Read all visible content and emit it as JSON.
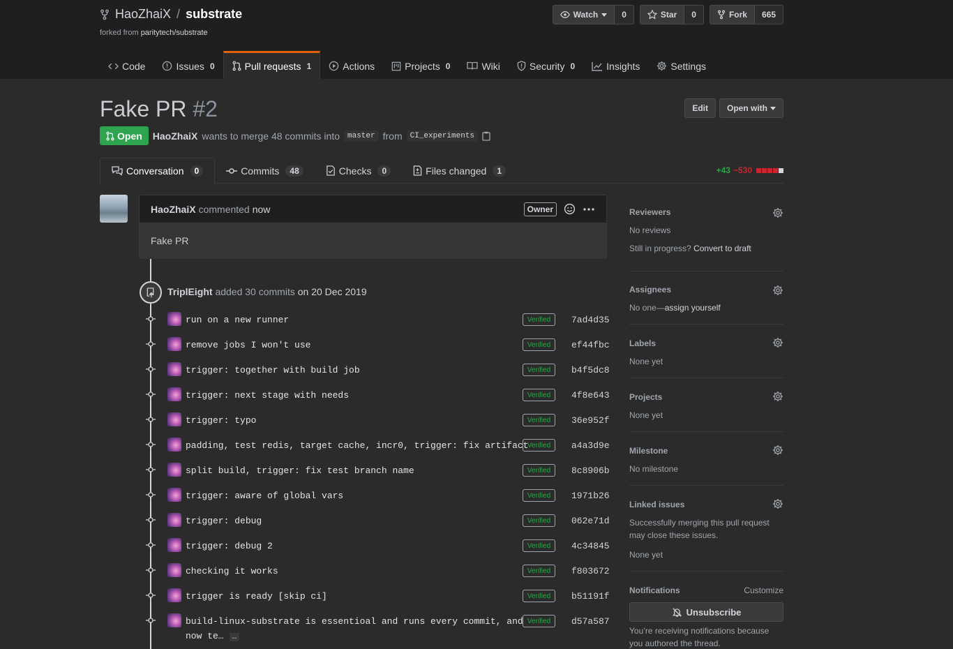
{
  "repo": {
    "owner": "HaoZhaiX",
    "separator": "/",
    "name": "substrate",
    "forked_prefix": "forked from ",
    "forked_from": "paritytech/substrate"
  },
  "actions": {
    "watch_label": "Watch",
    "watch_count": "0",
    "star_label": "Star",
    "star_count": "0",
    "fork_label": "Fork",
    "fork_count": "665"
  },
  "reponav": {
    "code": "Code",
    "issues": "Issues",
    "issues_count": "0",
    "pulls": "Pull requests",
    "pulls_count": "1",
    "actions": "Actions",
    "projects": "Projects",
    "projects_count": "0",
    "wiki": "Wiki",
    "security": "Security",
    "security_count": "0",
    "insights": "Insights",
    "settings": "Settings"
  },
  "pr": {
    "title": "Fake PR",
    "number": "#2",
    "edit_label": "Edit",
    "open_with_label": "Open with",
    "state": "Open",
    "author": "HaoZhaiX",
    "merge_text": "wants to merge 48 commits into",
    "base": "master",
    "from_text": "from",
    "head": "CI_experiments"
  },
  "tabs": {
    "conversation": "Conversation",
    "conversation_count": "0",
    "commits": "Commits",
    "commits_count": "48",
    "checks": "Checks",
    "checks_count": "0",
    "files": "Files changed",
    "files_count": "1",
    "additions": "+43",
    "deletions": "−530"
  },
  "comment": {
    "author": "HaoZhaiX",
    "action": "commented",
    "time": "now",
    "badge": "Owner",
    "body": "Fake PR"
  },
  "push_event": {
    "actor": "TriplEight",
    "action": "added 30 commits",
    "on_prefix": "on",
    "date": "20 Dec 2019"
  },
  "commits": [
    {
      "message": "run on a new runner",
      "verified": "Verified",
      "sha": "7ad4d35"
    },
    {
      "message": "remove jobs I won't use",
      "verified": "Verified",
      "sha": "ef44fbc"
    },
    {
      "message": "trigger: together with build job",
      "verified": "Verified",
      "sha": "b4f5dc8"
    },
    {
      "message": "trigger: next stage with needs",
      "verified": "Verified",
      "sha": "4f8e643"
    },
    {
      "message": "trigger: typo",
      "verified": "Verified",
      "sha": "36e952f"
    },
    {
      "message": "padding, test redis, target cache, incr0, trigger: fix artifact",
      "verified": "Verified",
      "sha": "a4a3d9e"
    },
    {
      "message": "split build, trigger: fix test branch name",
      "verified": "Verified",
      "sha": "8c8906b"
    },
    {
      "message": "trigger: aware of global vars",
      "verified": "Verified",
      "sha": "1971b26"
    },
    {
      "message": "trigger: debug",
      "verified": "Verified",
      "sha": "062e71d"
    },
    {
      "message": "trigger: debug 2",
      "verified": "Verified",
      "sha": "4c34845"
    },
    {
      "message": "checking it works",
      "verified": "Verified",
      "sha": "f803672"
    },
    {
      "message": "trigger is ready [skip ci]",
      "verified": "Verified",
      "sha": "b51191f"
    },
    {
      "message": "build-linux-substrate is essentioal and runs every commit, and",
      "message_line2": "now te…",
      "ellipsis": "…",
      "verified": "Verified",
      "sha": "d57a587"
    }
  ],
  "sidebar": {
    "reviewers_title": "Reviewers",
    "reviewers_text": "No reviews",
    "draft_prefix": "Still in progress?",
    "draft_link": "Convert to draft",
    "assignees_title": "Assignees",
    "assignees_prefix": "No one—",
    "assignees_link": "assign yourself",
    "labels_title": "Labels",
    "labels_text": "None yet",
    "projects_title": "Projects",
    "projects_text": "None yet",
    "milestone_title": "Milestone",
    "milestone_text": "No milestone",
    "linked_title": "Linked issues",
    "linked_line1": "Successfully merging this pull request",
    "linked_line2": "may close these issues.",
    "linked_none": "None yet",
    "notifications_title": "Notifications",
    "customize": "Customize",
    "unsubscribe": "Unsubscribe",
    "notif_line1": "You’re receiving notifications because",
    "notif_line2": "you authored the thread."
  },
  "colors": {
    "open_green": "#2ea44f",
    "verified_green": "#28a745",
    "deletion_red": "#cb2431",
    "tab_accent": "#e36209"
  }
}
